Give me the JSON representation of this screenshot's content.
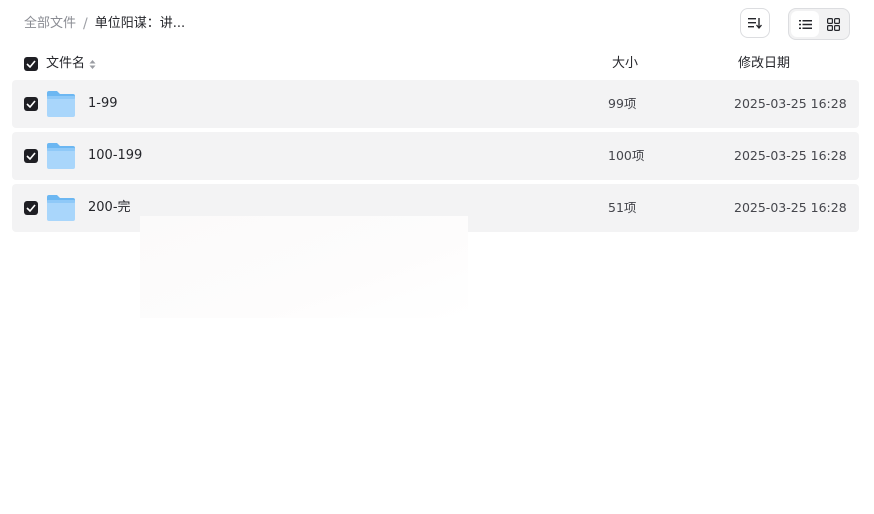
{
  "breadcrumb": {
    "root": "全部文件",
    "separator": "/",
    "current": "单位阳谋：讲..."
  },
  "toolbar": {
    "sort_icon": "sort-icon",
    "list_view_icon": "list-view-icon",
    "grid_view_icon": "grid-view-icon",
    "active_view": "list"
  },
  "columns": {
    "name": "文件名",
    "size": "大小",
    "date": "修改日期"
  },
  "files": [
    {
      "name": "1-99",
      "size": "99项",
      "date": "2025-03-25 16:28",
      "checked": true,
      "icon": "folder-icon"
    },
    {
      "name": "100-199",
      "size": "100项",
      "date": "2025-03-25 16:28",
      "checked": true,
      "icon": "folder-icon"
    },
    {
      "name": "200-完",
      "size": "51项",
      "date": "2025-03-25 16:28",
      "checked": true,
      "icon": "folder-icon"
    }
  ],
  "colors": {
    "row_bg": "#f3f3f4",
    "checkbox": "#1f1f24",
    "folder_light": "#a9d6fb",
    "folder_dark": "#6cb7f2"
  }
}
